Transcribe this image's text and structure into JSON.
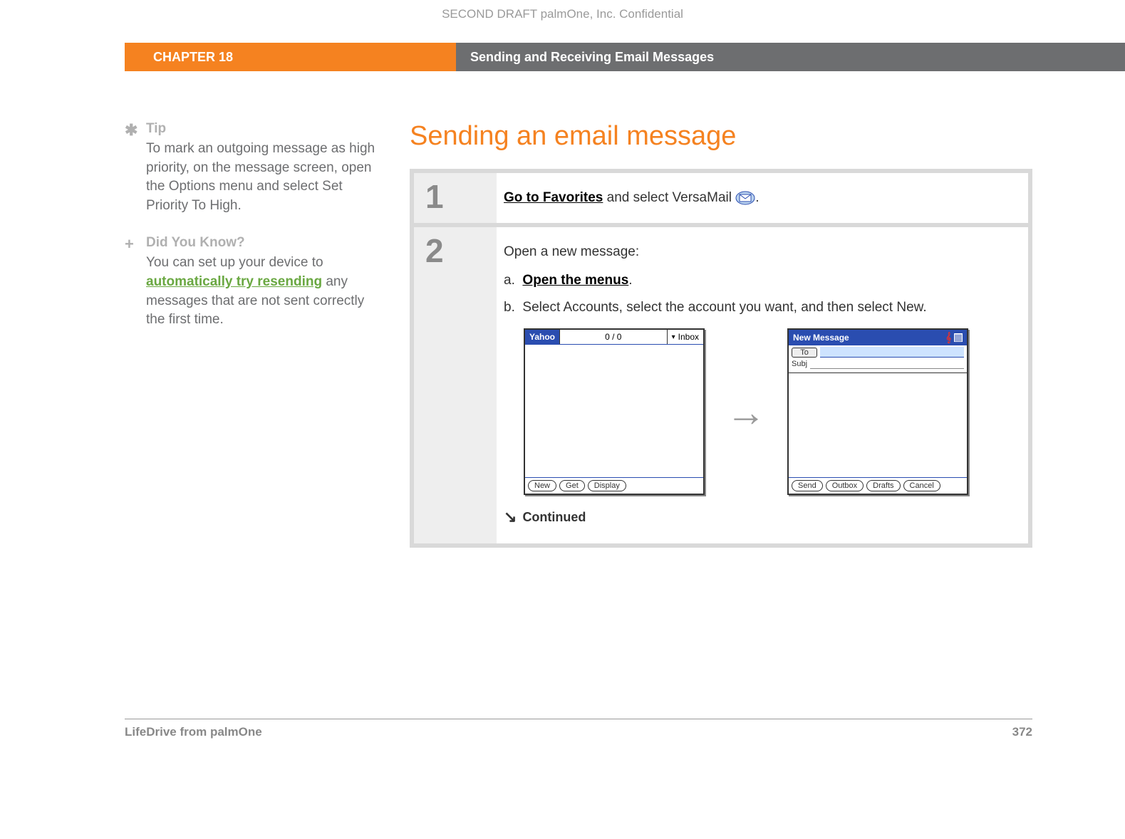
{
  "header": {
    "confidential": "SECOND DRAFT palmOne, Inc.  Confidential",
    "chapter": "CHAPTER 18",
    "title": "Sending and Receiving Email Messages"
  },
  "sidebar": {
    "tip": {
      "heading": "Tip",
      "body": "To mark an outgoing message as high priority, on the message screen, open the Options menu and select Set Priority To High."
    },
    "didyouknow": {
      "heading": "Did You Know?",
      "body_pre": "You can set up your device to ",
      "link": "automatically try resending",
      "body_post": " any messages that are not sent correctly the first time."
    }
  },
  "main": {
    "heading": "Sending an email message",
    "steps": [
      {
        "num": "1",
        "pre_link": "Go to Favorites",
        "post_link": " and select VersaMail ",
        "trail": "."
      },
      {
        "num": "2",
        "intro": "Open a new message:",
        "sub_a_label": "a.",
        "sub_a_link": "Open the menus",
        "sub_a_trail": ".",
        "sub_b_label": "b.",
        "sub_b_text": "Select Accounts, select the account you want, and then select New."
      }
    ],
    "screens": {
      "inbox": {
        "account": "Yahoo",
        "counter": "0 / 0",
        "folder": "Inbox",
        "buttons": [
          "New",
          "Get",
          "Display"
        ]
      },
      "newmsg": {
        "title": "New Message",
        "to": "To",
        "subj": "Subj",
        "buttons": [
          "Send",
          "Outbox",
          "Drafts",
          "Cancel"
        ]
      }
    },
    "continued": "Continued"
  },
  "footer": {
    "product": "LifeDrive from palmOne",
    "page": "372"
  }
}
